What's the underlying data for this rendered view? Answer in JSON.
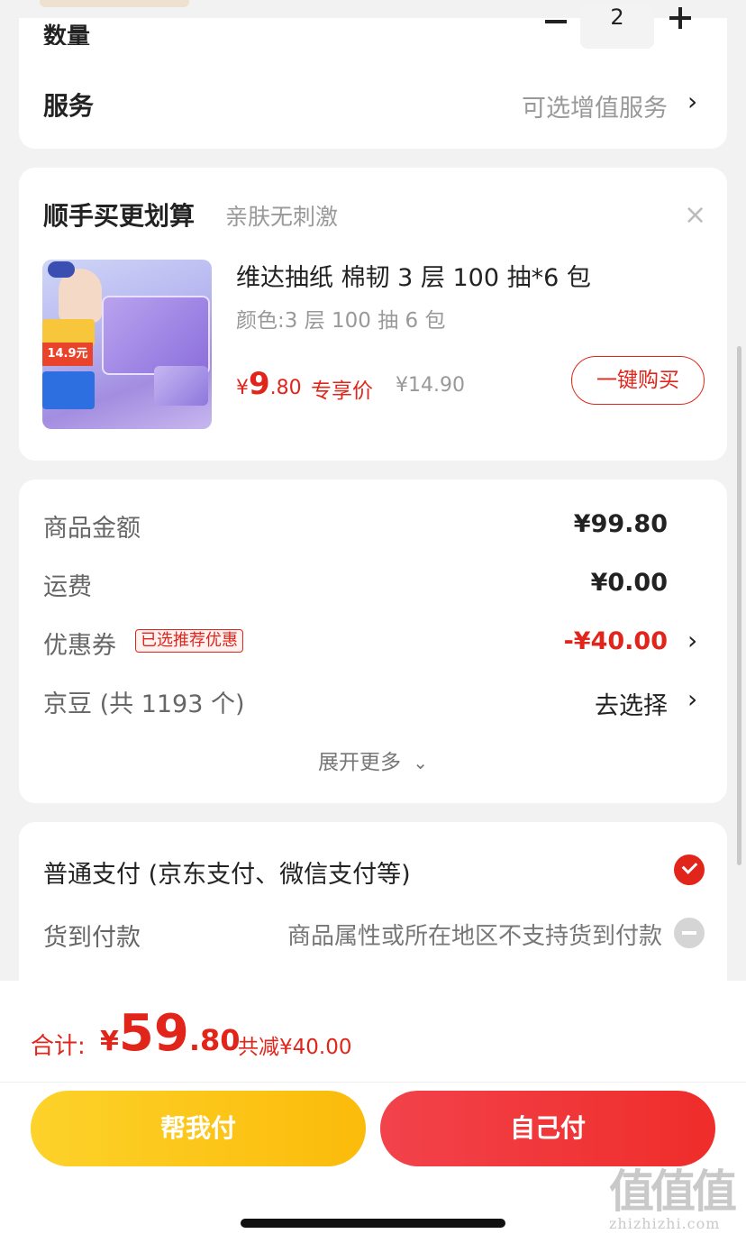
{
  "quantity": {
    "label": "数量",
    "value": "2"
  },
  "service": {
    "label": "服务",
    "value": "可选增值服务"
  },
  "recommend": {
    "title": "顺手买更划算",
    "subtitle": "亲肤无刺激",
    "product_name": "维达抽纸 棉韧 3 层 100 抽*6 包",
    "spec": "颜色:3 层 100 抽 6 包",
    "price_symbol": "¥",
    "price_int": "9",
    "price_dec": ".80",
    "exclusive_label": "专享价",
    "original_price": "¥14.90",
    "buy_button": "一键购买",
    "image_banner_price": "14.9元"
  },
  "summary": {
    "goods_label": "商品金额",
    "goods_value": "¥99.80",
    "shipping_label": "运费",
    "shipping_value": "¥0.00",
    "coupon_label": "优惠券",
    "coupon_badge": "已选推荐优惠",
    "coupon_value": "-¥40.00",
    "jingdou_label": "京豆 (共 1193 个)",
    "jingdou_value": "去选择",
    "expand_more": "展开更多"
  },
  "payment": {
    "normal_label": "普通支付 (京东支付、微信支付等)",
    "cod_label": "货到付款",
    "cod_note": "商品属性或所在地区不支持货到付款"
  },
  "footer": {
    "total_label": "合计:",
    "total_symbol": "¥",
    "total_int": "59",
    "total_dec": ".80",
    "total_saving": "共减¥40.00",
    "help_pay": "帮我付",
    "self_pay": "自己付"
  },
  "watermark": {
    "glyph": "值值值",
    "site": "zhizhizhi.com"
  },
  "colors": {
    "accent_red": "#e1251b",
    "yellow_button": "#fcc81b"
  }
}
